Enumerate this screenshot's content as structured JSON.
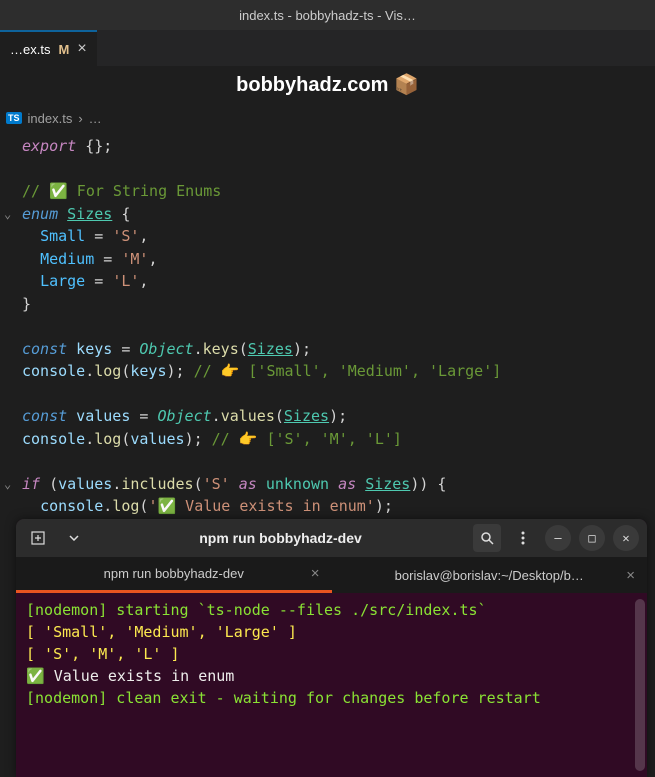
{
  "window": {
    "title": "index.ts - bobbyhadz-ts - Vis…"
  },
  "tab": {
    "filename": "…ex.ts",
    "modified": "M",
    "close": "×"
  },
  "banner": {
    "text": "bobbyhadz.com 📦"
  },
  "breadcrumb": {
    "badge": "TS",
    "file": "index.ts",
    "sep": "›",
    "more": "…"
  },
  "code": {
    "l1_export": "export",
    "l1_braces": " {};",
    "l3_comment": "// ✅ For String Enums",
    "l4_enum": "enum",
    "l4_name": "Sizes",
    "l4_brace": " {",
    "l5_member": "Small",
    "l5_eq": " = ",
    "l5_val": "'S'",
    "l5_comma": ",",
    "l6_member": "Medium",
    "l6_eq": " = ",
    "l6_val": "'M'",
    "l6_comma": ",",
    "l7_member": "Large",
    "l7_eq": " = ",
    "l7_val": "'L'",
    "l7_comma": ",",
    "l8_brace": "}",
    "l10_const": "const",
    "l10_keys": " keys ",
    "l10_eq": "= ",
    "l10_obj": "Object",
    "l10_dot": ".",
    "l10_fn": "keys",
    "l10_p1": "(",
    "l10_arg": "Sizes",
    "l10_p2": ");",
    "l11_console": "console",
    "l11_dot": ".",
    "l11_log": "log",
    "l11_p1": "(",
    "l11_arg": "keys",
    "l11_p2": "); ",
    "l11_comment": "// 👉️ ['Small', 'Medium', 'Large']",
    "l13_const": "const",
    "l13_values": " values ",
    "l13_eq": "= ",
    "l13_obj": "Object",
    "l13_dot": ".",
    "l13_fn": "values",
    "l13_p1": "(",
    "l13_arg": "Sizes",
    "l13_p2": ");",
    "l14_console": "console",
    "l14_dot": ".",
    "l14_log": "log",
    "l14_p1": "(",
    "l14_arg": "values",
    "l14_p2": "); ",
    "l14_comment": "// 👉️ ['S', 'M', 'L']",
    "l16_if": "if",
    "l16_p1": " (",
    "l16_values": "values",
    "l16_dot": ".",
    "l16_inc": "includes",
    "l16_p2": "(",
    "l16_str": "'S'",
    "l16_as1": " as ",
    "l16_unk": "unknown",
    "l16_as2": " as ",
    "l16_sizes": "Sizes",
    "l16_p3": ")) {",
    "l17_console": "console",
    "l17_dot": ".",
    "l17_log": "log",
    "l17_p1": "(",
    "l17_str": "'✅ Value exists in enum'",
    "l17_p2": ");",
    "l18_brace": "}"
  },
  "terminal": {
    "title": "npm run bobbyhadz-dev",
    "tabs": [
      {
        "label": "npm run bobbyhadz-dev",
        "active": true
      },
      {
        "label": "borislav@borislav:~/Desktop/b…",
        "active": false
      }
    ],
    "lines": [
      {
        "cls": "t-green",
        "text": "[nodemon] starting `ts-node --files ./src/index.ts`"
      },
      {
        "cls": "t-yellow",
        "text": "[ 'Small', 'Medium', 'Large' ]"
      },
      {
        "cls": "t-yellow",
        "text": "[ 'S', 'M', 'L' ]"
      },
      {
        "cls": "t-white",
        "text": "✅ Value exists in enum"
      },
      {
        "cls": "t-green",
        "text": "[nodemon] clean exit - waiting for changes before restart"
      }
    ]
  }
}
